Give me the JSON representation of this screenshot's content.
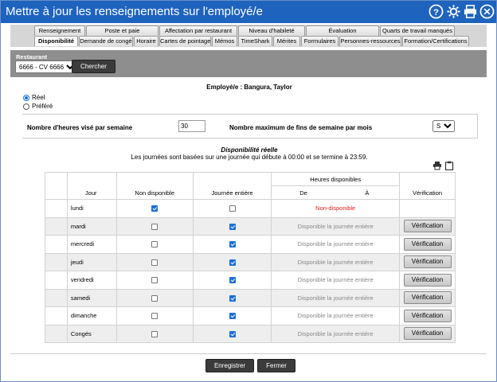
{
  "window": {
    "title": "Mettre à jour les renseignements sur l'employé/e"
  },
  "titlebar_icons": [
    "help-icon",
    "gear-icon",
    "print-icon",
    "close-icon"
  ],
  "tabs_row1": [
    "Renseignement",
    "Poste et paie",
    "Affectation par restaurant",
    "Niveau d'habileté",
    "Évaluation",
    "Quarts de travail manqués"
  ],
  "tabs_row2": [
    "Disponibilité",
    "Demande de congé",
    "Horaire",
    "Cartes de pointage",
    "Mémos",
    "TimeShark",
    "Mérites",
    "Formulaires",
    "Personnes-ressources",
    "Formation/Certifications"
  ],
  "active_tab": "Disponibilité",
  "search": {
    "label": "Restaurant",
    "restaurant_value": "6666 - CV 6666",
    "button": "Chercher"
  },
  "employee_line": "Employé/e : Bangura, Taylor",
  "mode": {
    "options": [
      "Réel",
      "Préféré"
    ],
    "selected": "Réel"
  },
  "hours": {
    "target_label": "Nombre d'heures visé par semaine",
    "target_value": "30",
    "max_weekends_label": "Nombre maximum de fins de semaine par mois",
    "max_weekends_value": "S.O."
  },
  "availability": {
    "title": "Disponibilité réelle",
    "subtitle": "Les journées sont basées sur une journée qui débute à 00:00 et se termine à 23:59."
  },
  "table": {
    "headers": {
      "day": "Jour",
      "not_available": "Non disponible",
      "whole_day": "Journée entière",
      "hours_available": "Heures disponibles",
      "from": "De",
      "to": "À",
      "verification": "Vérification"
    },
    "rows": [
      {
        "day": "lundi",
        "not_available": true,
        "whole_day": false,
        "status": "Non-disponible",
        "status_type": "unavailable",
        "verify": ""
      },
      {
        "day": "mardi",
        "not_available": false,
        "whole_day": true,
        "status": "Disponible la journée entière",
        "status_type": "available",
        "verify": "Vérification"
      },
      {
        "day": "mercredi",
        "not_available": false,
        "whole_day": true,
        "status": "Disponible la journée entière",
        "status_type": "available",
        "verify": "Vérification"
      },
      {
        "day": "jeudi",
        "not_available": false,
        "whole_day": true,
        "status": "Disponible la journée entière",
        "status_type": "available",
        "verify": "Vérification"
      },
      {
        "day": "vendredi",
        "not_available": false,
        "whole_day": true,
        "status": "Disponible la journée entière",
        "status_type": "available",
        "verify": "Vérification"
      },
      {
        "day": "samedi",
        "not_available": false,
        "whole_day": true,
        "status": "Disponible la journée entière",
        "status_type": "available",
        "verify": "Vérification"
      },
      {
        "day": "dimanche",
        "not_available": false,
        "whole_day": true,
        "status": "Disponible la journée entière",
        "status_type": "available",
        "verify": "Vérification"
      },
      {
        "day": "Congés",
        "not_available": false,
        "whole_day": true,
        "status": "Disponible la journée entière",
        "status_type": "available",
        "verify": "Vérification"
      }
    ]
  },
  "footer": {
    "save": "Enregistrer",
    "close": "Fermer"
  },
  "colors": {
    "titlebar": "#1e63bd",
    "search_bar": "#8e8e8e",
    "unavailable_text": "#e02020",
    "checkbox_on": "#1a6fd9"
  }
}
